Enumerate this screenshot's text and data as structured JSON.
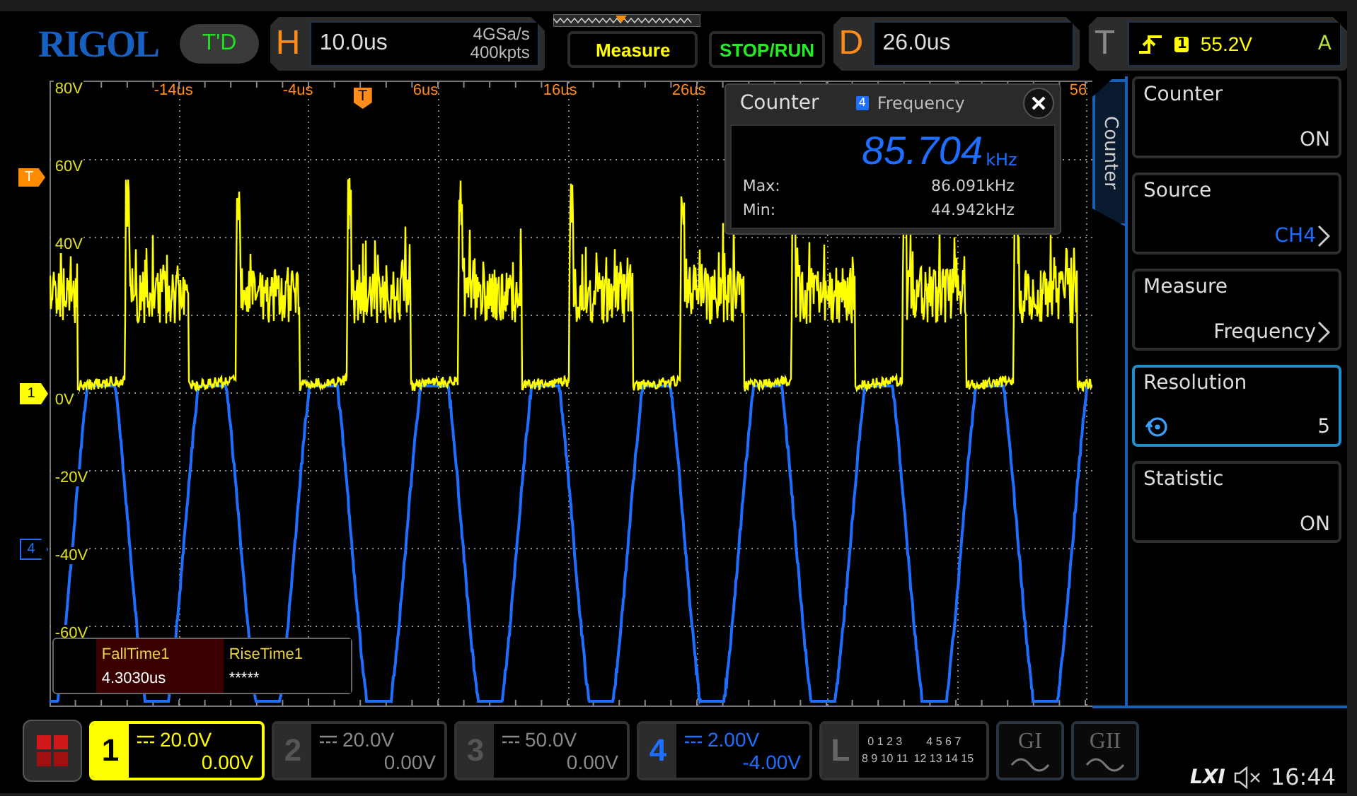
{
  "top_bar": {
    "logo": "RIGOL",
    "run_status": "T'D",
    "horizontal": {
      "letter": "H",
      "timebase": "10.0us",
      "sample_rate": "4GSa/s",
      "memory_depth": "400kpts"
    },
    "measure_button": "Measure",
    "run_button": "STOP/RUN",
    "delay": {
      "letter": "D",
      "value": "26.0us"
    },
    "trigger": {
      "letter": "T",
      "source": "1",
      "level": "55.2V",
      "mode": "A"
    }
  },
  "display": {
    "time_labels": [
      "-14us",
      "-4us",
      "6us",
      "16us",
      "26us",
      "56"
    ],
    "volt_labels": [
      "80V",
      "60V",
      "40V",
      "0V",
      "-20V",
      "-40V",
      "-60V"
    ],
    "trigger_position": "T",
    "markers": [
      {
        "label": "T",
        "kind": "trigger",
        "color": "#ff8c00"
      },
      {
        "label": "1",
        "kind": "channel",
        "color": "#ffff00"
      },
      {
        "label": "4",
        "kind": "channel",
        "color": "#1e6fff"
      }
    ]
  },
  "counter_popup": {
    "title": "Counter",
    "source": "4",
    "measure": "Frequency",
    "value": "85.704",
    "unit": "kHz",
    "stats": [
      {
        "label": "Max:",
        "value": "86.091kHz"
      },
      {
        "label": "Min:",
        "value": "44.942kHz"
      }
    ]
  },
  "measurements": [
    {
      "name": "FallTime1",
      "value": "4.3030us",
      "selected": true
    },
    {
      "name": "RiseTime1",
      "value": "*****",
      "selected": false
    }
  ],
  "side_menu": {
    "tab": "Counter",
    "items": [
      {
        "label": "Counter",
        "value": "ON",
        "kind": "plain",
        "selected": false
      },
      {
        "label": "Source",
        "value": "CH4",
        "kind": "choice",
        "selected": false
      },
      {
        "label": "Measure",
        "value": "Frequency",
        "kind": "choice",
        "selected": false
      },
      {
        "label": "Resolution",
        "value": "5",
        "kind": "knob",
        "selected": true
      },
      {
        "label": "Statistic",
        "value": "ON",
        "kind": "plain",
        "selected": false
      }
    ]
  },
  "channels": [
    {
      "number": "1",
      "scale": "20.0V",
      "offset": "0.00V",
      "on": true,
      "selected": true,
      "color": "#ffff00"
    },
    {
      "number": "2",
      "scale": "20.0V",
      "offset": "0.00V",
      "on": false,
      "selected": false
    },
    {
      "number": "3",
      "scale": "50.0V",
      "offset": "0.00V",
      "on": false,
      "selected": false
    },
    {
      "number": "4",
      "scale": "2.00V",
      "offset": "-4.00V",
      "on": true,
      "selected": false,
      "color": "#1e6fff"
    }
  ],
  "logic": {
    "letter": "L",
    "rows": [
      "0 1 2 3",
      "4 5 6 7",
      "8 9 10 11",
      "12 13 14 15"
    ]
  },
  "generators": [
    {
      "label": "GI"
    },
    {
      "label": "GII"
    }
  ],
  "status": {
    "lxi": "LXI",
    "time": "16:44"
  }
}
